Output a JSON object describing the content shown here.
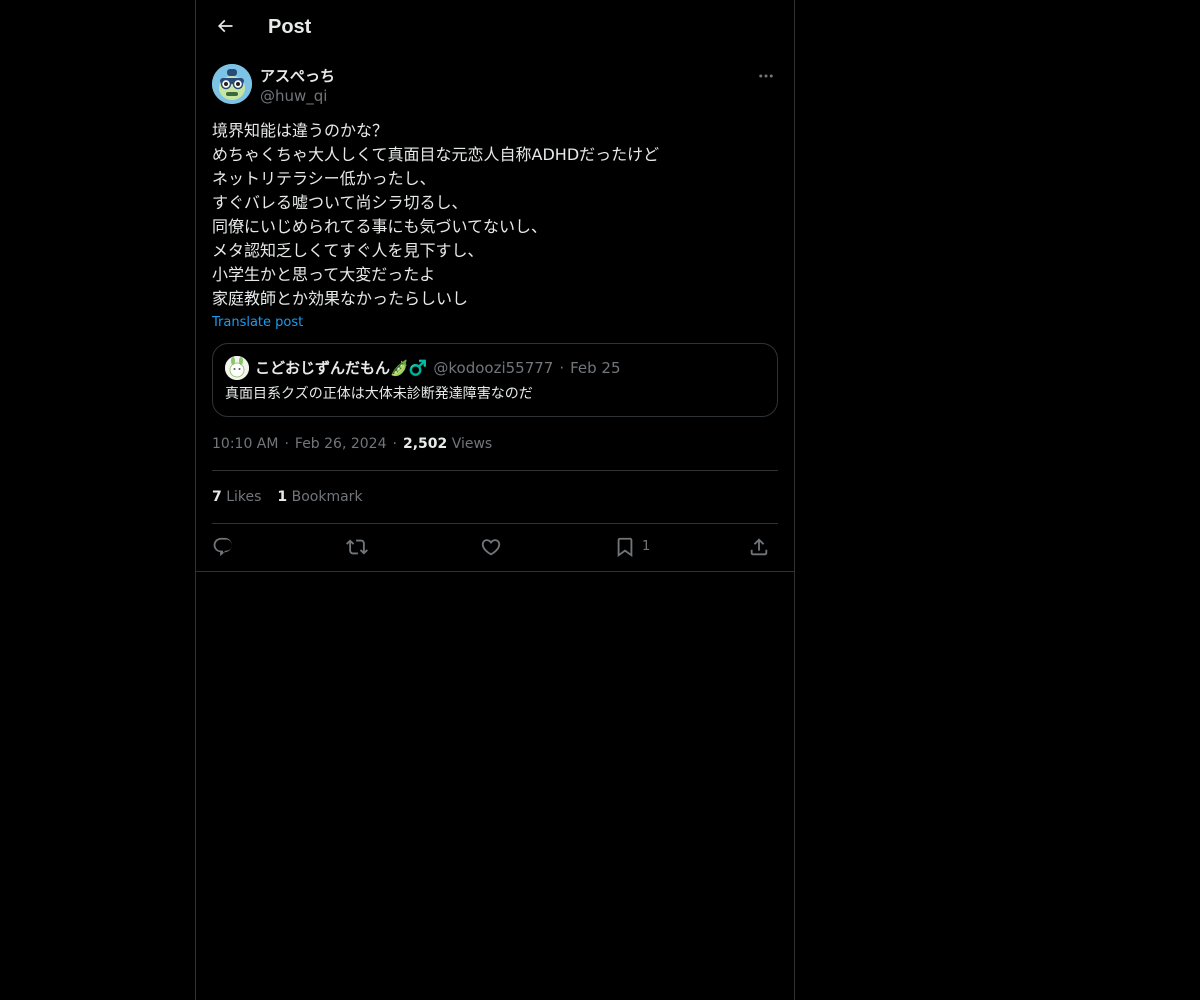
{
  "header": {
    "title": "Post"
  },
  "post": {
    "author": {
      "display_name": "アスぺっち",
      "handle": "@huw_qi"
    },
    "lines": [
      "境界知能は違うのかな？",
      "めちゃくちゃ大人しくて真面目な元恋人自称ADHDだったけど",
      "ネットリテラシー低かったし、",
      "すぐバレる嘘ついて尚シラ切るし、",
      "同僚にいじめられてる事にも気づいてないし、",
      "メタ認知乏しくてすぐ人を見下すし、",
      "小学生かと思って大変だったよ",
      "家庭教師とか効果なかったらしいし"
    ],
    "translate_label": "Translate post",
    "quote": {
      "display_name": "こどおじずんだもん🫛♂️",
      "handle": "@kodoozi55777",
      "separator": "·",
      "date": "Feb 25",
      "text": "真面目系クズの正体は大体未診断発達障害なのだ"
    },
    "meta": {
      "time": "10:10 AM",
      "separator": "·",
      "date": "Feb 26, 2024",
      "views_count": "2,502",
      "views_label": "Views"
    },
    "stats": {
      "likes_count": "7",
      "likes_label": "Likes",
      "bookmarks_count": "1",
      "bookmarks_label": "Bookmark"
    },
    "actions": {
      "bookmark_count": "1"
    }
  },
  "colors": {
    "background": "#000000",
    "text": "#e7e9ea",
    "secondary": "#71767b",
    "border": "#2f3336",
    "accent": "#1d9bf0"
  },
  "icons": [
    "back-arrow-icon",
    "more-icon",
    "reply-icon",
    "repost-icon",
    "like-icon",
    "bookmark-icon",
    "share-icon"
  ]
}
